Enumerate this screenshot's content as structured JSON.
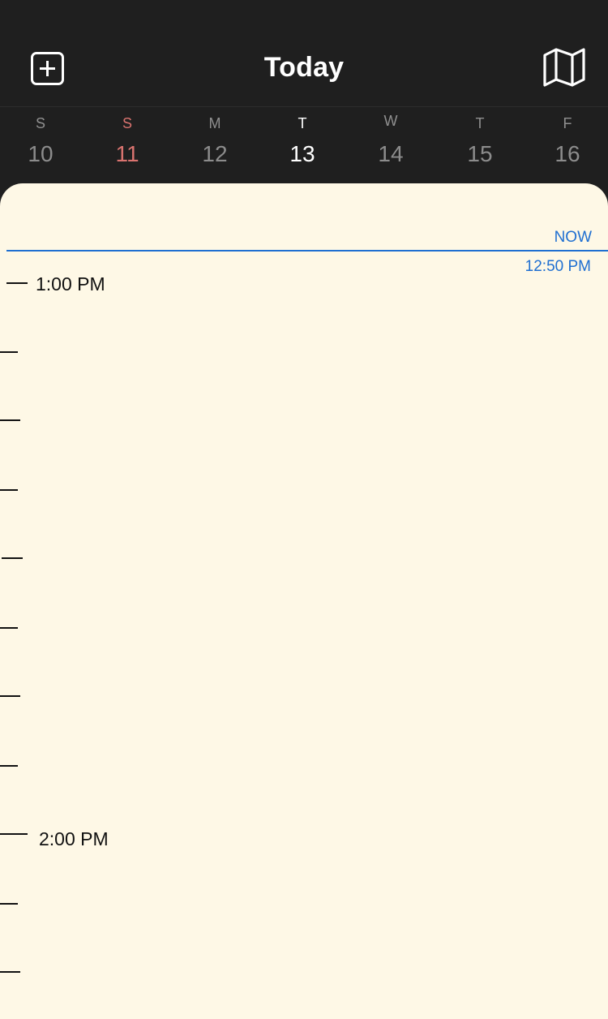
{
  "header": {
    "title": "Today",
    "add_icon": "add-event-icon",
    "map_icon": "map-icon"
  },
  "week": {
    "days": [
      {
        "dow": "S",
        "num": "10"
      },
      {
        "dow": "S",
        "num": "11"
      },
      {
        "dow": "M",
        "num": "12"
      },
      {
        "dow": "T",
        "num": "13"
      },
      {
        "dow": "W",
        "num": "14"
      },
      {
        "dow": "T",
        "num": "15"
      },
      {
        "dow": "F",
        "num": "16"
      }
    ]
  },
  "timeline": {
    "now_label": "NOW",
    "now_time": "12:50 PM",
    "hours": [
      "1:00 PM",
      "2:00 PM"
    ]
  },
  "colors": {
    "background_dark": "#1f1f1f",
    "panel": "#fef8e6",
    "now_accent": "#1f6fd1",
    "sunday": "#d9736f"
  }
}
